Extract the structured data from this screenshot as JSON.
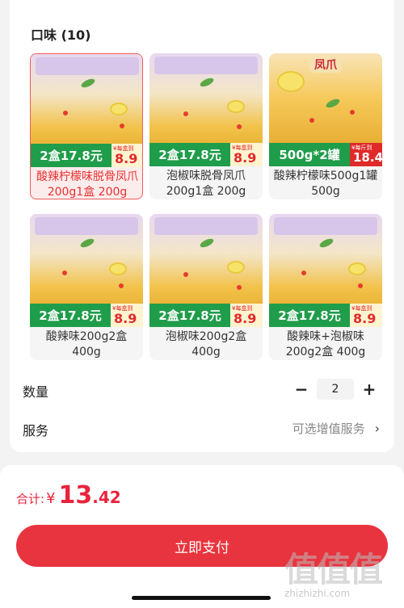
{
  "flavor_section": {
    "title": "口味 (10)",
    "options": [
      {
        "name": "酸辣柠檬味脱骨凤爪200g1盒 200g",
        "band_text": "2盒17.8元",
        "per_box": "¥每盒到",
        "per_price": "8.9",
        "selected": true
      },
      {
        "name": "泡椒味脱骨凤爪200g1盒 200g",
        "band_text": "2盒17.8元",
        "per_box": "¥每盒到",
        "per_price": "8.9",
        "selected": false
      },
      {
        "name": "酸辣柠檬味500g1罐 500g",
        "band_text": "500g*2罐",
        "per_box": "¥每斤到",
        "per_price": "18.4",
        "jar_title": "凤爪",
        "selected": false
      },
      {
        "name": "酸辣味200g2盒400g",
        "band_text": "2盒17.8元",
        "per_box": "¥每盒到",
        "per_price": "8.9",
        "selected": false
      },
      {
        "name": "泡椒味200g2盒400g",
        "band_text": "2盒17.8元",
        "per_box": "¥每盒到",
        "per_price": "8.9",
        "selected": false
      },
      {
        "name": "酸辣味+泡椒味200g2盒 400g",
        "band_text": "2盒17.8元",
        "per_box": "¥每盒到",
        "per_price": "8.9",
        "selected": false
      }
    ]
  },
  "quantity": {
    "label": "数量",
    "value": "2",
    "minus": "−",
    "plus": "+"
  },
  "service": {
    "label": "服务",
    "value": "可选增值服务",
    "chevron": "›"
  },
  "summary": {
    "total_label": "合计:",
    "currency": "¥",
    "amount_int": "13",
    "amount_dec": ".42"
  },
  "pay_button": {
    "label": "立即支付"
  },
  "watermark": {
    "big": "值值值",
    "small": "zhizhizhi.com"
  },
  "colors": {
    "accent": "#e8343e",
    "price_red": "#e8243c",
    "band_green": "#1f9d4a"
  }
}
